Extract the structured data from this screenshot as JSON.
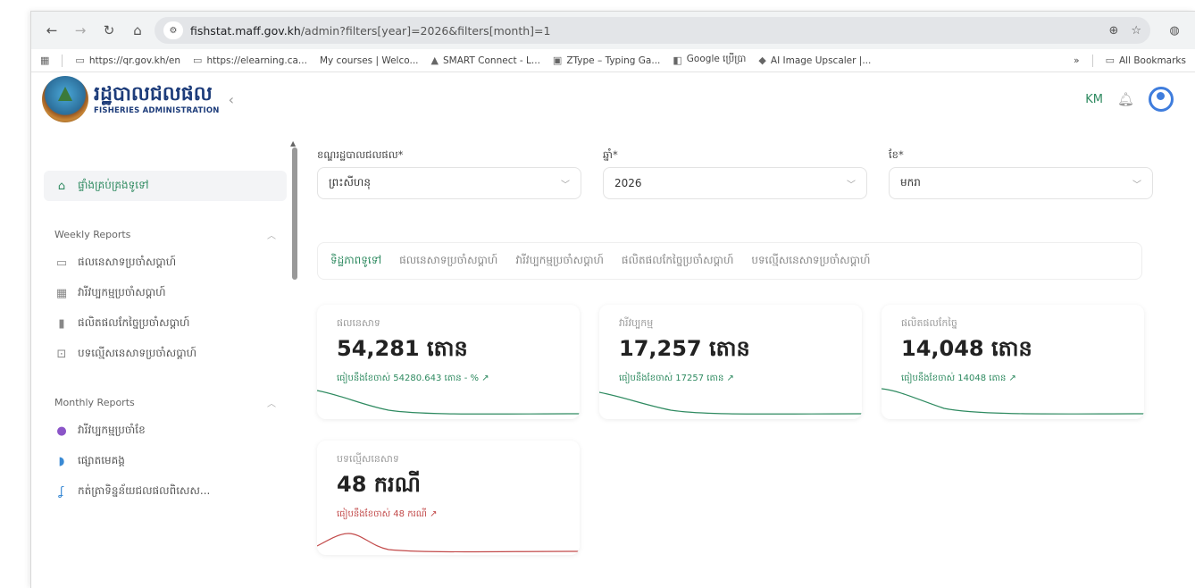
{
  "browser": {
    "url_host": "fishstat.maff.gov.kh",
    "url_path": "/admin?filters[year]=2026&filters[month]=1",
    "bookmarks": [
      "https://qr.gov.kh/en",
      "https://elearning.ca...",
      "My courses | Welco...",
      "SMART Connect - L...",
      "ZType – Typing Ga...",
      "Google ប្រើប្រា",
      "AI Image Upscaler |..."
    ],
    "all_bookmarks": "All Bookmarks",
    "more": "»"
  },
  "header": {
    "logo_kh": "រដ្ឋបាលជលផល",
    "logo_en": "FISHERIES ADMINISTRATION",
    "lang": "KM"
  },
  "sidebar": {
    "home": "ផ្ទាំងគ្រប់គ្រងទូទៅ",
    "weekly_title": "Weekly Reports",
    "weekly_items": [
      "ផលនេសាទប្រចាំសប្តាហ៍",
      "វារីវប្បកម្មប្រចាំសប្តាហ៍",
      "ផលិតផលកែច្នៃប្រចាំសប្តាហ៍",
      "បទល្មើសនេសាទប្រចាំសប្តាហ៍"
    ],
    "monthly_title": "Monthly Reports",
    "monthly_items": [
      "វារីវប្បកម្មប្រចាំខែ",
      "ផ្សោតមេគង្គ",
      "កត់ត្រាទិន្នន័យជលផលពិសេស..."
    ]
  },
  "filters": {
    "admin_label": "ខណ្ឌរដ្ឋបាលជលផល*",
    "admin_value": "ព្រះសីហនុ",
    "year_label": "ឆ្នាំ*",
    "year_value": "2026",
    "month_label": "ខែ*",
    "month_value": "មករា"
  },
  "tabs": [
    "ទិដ្ឋភាពទូទៅ",
    "ផលនេសាទប្រចាំសប្តាហ៍",
    "វារីវប្បកម្មប្រចាំសប្តាហ៍",
    "ផលិតផលកែច្នៃប្រចាំសប្តាហ៍",
    "បទល្មើសនេសាទប្រចាំសប្តាហ៍"
  ],
  "cards": [
    {
      "label": "ផលនេសាទ",
      "value": "54,281 តោន",
      "sub": "ធៀបនឹងខែចាស់ 54280.643 តោន - % ↗"
    },
    {
      "label": "វារីវប្បកម្ម",
      "value": "17,257 តោន",
      "sub": "ធៀបនឹងខែចាស់ 17257 តោន ↗"
    },
    {
      "label": "ផលិតផលកែច្នៃ",
      "value": "14,048 តោន",
      "sub": "ធៀបនឹងខែចាស់ 14048 តោន ↗"
    },
    {
      "label": "បទល្មើសនេសាទ",
      "value": "48 ករណី",
      "sub": "ធៀបនឹងខែចាស់ 48 ករណី ↗"
    }
  ],
  "colors": {
    "accent": "#2e8a60",
    "alert": "#c24a4a",
    "avatar": "#3f7ddd"
  }
}
